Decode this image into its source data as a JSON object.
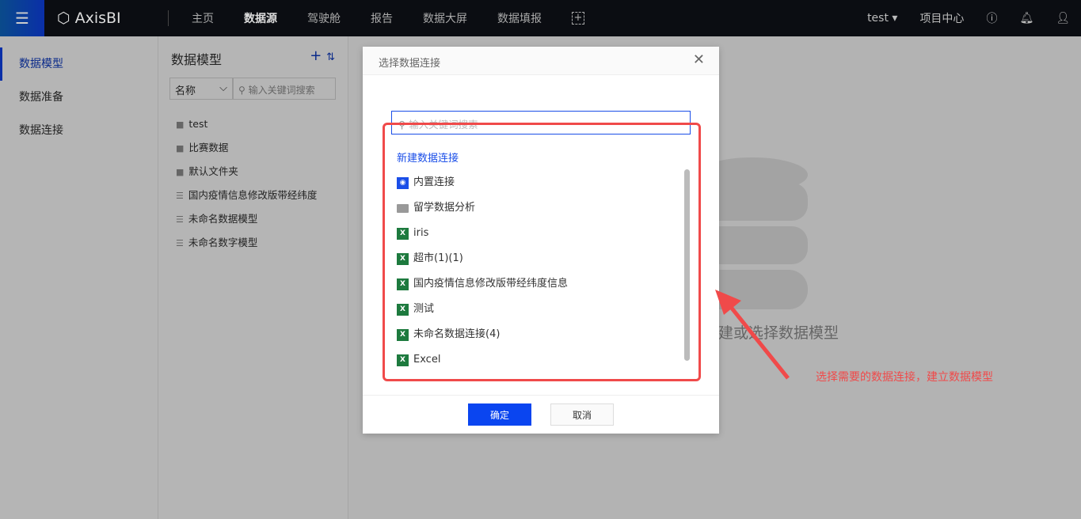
{
  "topbar": {
    "logo": "AxisBI",
    "nav": [
      "主页",
      "数据源",
      "驾驶舱",
      "报告",
      "数据大屏",
      "数据填报"
    ],
    "active": "数据源",
    "user": "test",
    "project_center": "项目中心"
  },
  "sidebar": {
    "items": [
      "数据模型",
      "数据准备",
      "数据连接"
    ],
    "active": "数据模型"
  },
  "panel": {
    "title": "数据模型",
    "sort_select": "名称",
    "search_placeholder": "输入关键词搜索",
    "tree": [
      {
        "type": "folder",
        "label": "test"
      },
      {
        "type": "folder",
        "label": "比赛数据"
      },
      {
        "type": "folder",
        "label": "默认文件夹"
      },
      {
        "type": "model",
        "label": "国内疫情信息修改版带经纬度"
      },
      {
        "type": "model",
        "label": "未命名数据模型"
      },
      {
        "type": "model",
        "label": "未命名数字模型"
      }
    ]
  },
  "main": {
    "empty_text": "新建或选择数据模型"
  },
  "modal": {
    "title": "选择数据连接",
    "search_placeholder": "输入关键词搜索",
    "new_connection": "新建数据连接",
    "items": [
      {
        "type": "builtin",
        "label": "内置连接"
      },
      {
        "type": "folder",
        "label": "留学数据分析"
      },
      {
        "type": "excel",
        "label": "iris"
      },
      {
        "type": "excel",
        "label": "超市(1)(1)"
      },
      {
        "type": "excel",
        "label": "国内疫情信息修改版带经纬度信息"
      },
      {
        "type": "excel",
        "label": "测试"
      },
      {
        "type": "excel",
        "label": "未命名数据连接(4)"
      },
      {
        "type": "excel",
        "label": "Excel"
      }
    ],
    "ok": "确定",
    "cancel": "取消"
  },
  "annotation": {
    "text": "选择需要的数据连接，建立数据模型",
    "color": "#f04a4a"
  },
  "colors": {
    "accent": "#1a4ee8",
    "excel": "#1d7a3e"
  }
}
